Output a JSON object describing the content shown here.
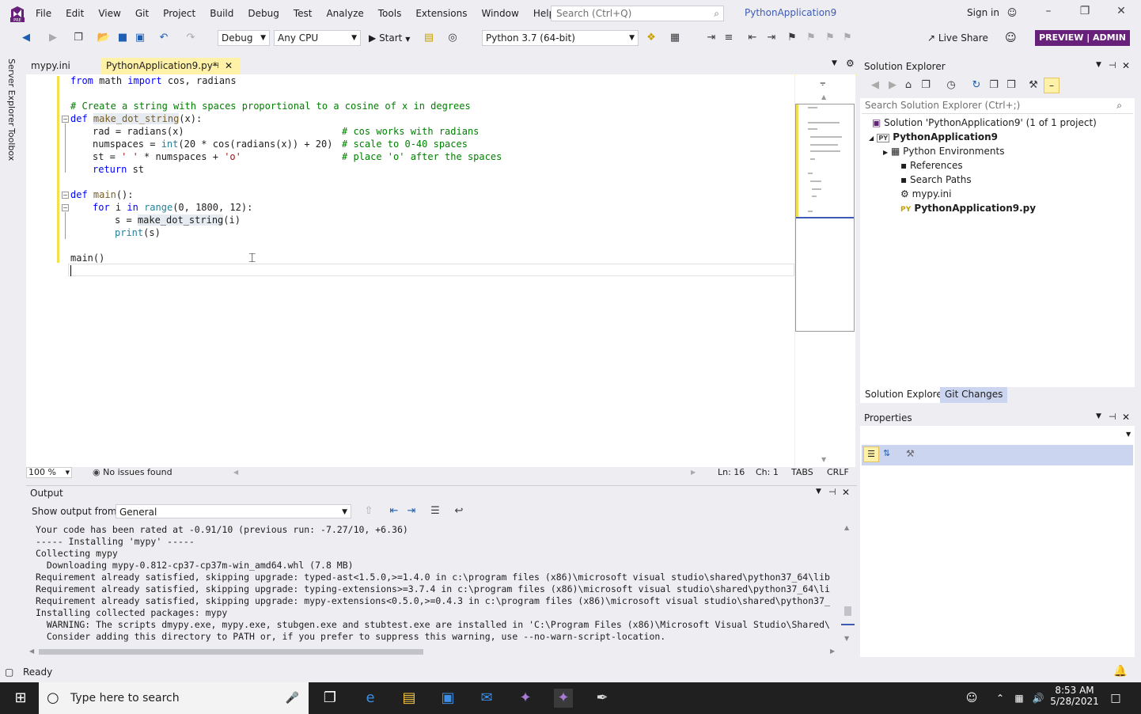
{
  "menu": [
    "File",
    "Edit",
    "View",
    "Git",
    "Project",
    "Build",
    "Debug",
    "Test",
    "Analyze",
    "Tools",
    "Extensions",
    "Window",
    "Help"
  ],
  "search_placeholder": "Search (Ctrl+Q)",
  "project_name": "PythonApplication9",
  "sign_in": "Sign in",
  "toolbar": {
    "config": "Debug",
    "platform": "Any CPU",
    "start": "Start",
    "env": "Python 3.7 (64-bit)",
    "live_share": "Live Share",
    "preview": "PREVIEW | ADMIN"
  },
  "left_rail": {
    "server_explorer": "Server Explorer",
    "toolbox": "Toolbox"
  },
  "tabs": {
    "mypy": "mypy.ini",
    "py": "PythonApplication9.py*"
  },
  "code": [
    {
      "t": "from",
      "c": "kw"
    },
    {
      "t": " math ",
      "c": ""
    },
    {
      "t": "import",
      "c": "kw"
    },
    {
      "t": " cos, radians",
      "c": ""
    }
  ],
  "code_lines": {
    "l1": [
      "from",
      "math",
      "import",
      "cos, radians"
    ],
    "comment": "# Create a string with spaces proportional to a cosine of x in degrees",
    "def1_kw": "def",
    "def1_name": "make_dot_string",
    "def1_args": "(x):",
    "l_rad": "rad = radians(x)",
    "c_rad": "# cos works with radians",
    "l_num_a": "numspaces = ",
    "l_num_int": "int",
    "l_num_b": "(20 * cos(radians(x)) + 20)",
    "c_num": "# scale to 0-40 spaces",
    "l_st_a": "st = ",
    "l_st_s1": "' '",
    "l_st_b": " * numspaces + ",
    "l_st_s2": "'o'",
    "c_st": "# place 'o' after the spaces",
    "l_ret_kw": "return",
    "l_ret": " st",
    "def2_kw": "def",
    "def2_name": "main",
    "def2_args": "():",
    "for_kw": "for",
    "for_a": " i ",
    "in_kw": "in",
    "range": "range",
    "for_b": "(0, 1800, 12):",
    "s_a": "s = ",
    "s_call": "make_dot_string",
    "s_b": "(i)",
    "print": "print",
    "print_b": "(s)",
    "main_call": "main()"
  },
  "editor_status": {
    "zoom": "100 %",
    "issues": "No issues found",
    "ln": "Ln: 16",
    "ch": "Ch: 1",
    "tabs": "TABS",
    "eol": "CRLF"
  },
  "output": {
    "title": "Output",
    "show_from_label": "Show output from:",
    "source": "General",
    "lines": [
      "Your code has been rated at -0.91/10 (previous run: -7.27/10, +6.36)",
      "----- Installing 'mypy' -----",
      "Collecting mypy",
      "  Downloading mypy-0.812-cp37-cp37m-win_amd64.whl (7.8 MB)",
      "Requirement already satisfied, skipping upgrade: typed-ast<1.5.0,>=1.4.0 in c:\\program files (x86)\\microsoft visual studio\\shared\\python37_64\\lib",
      "Requirement already satisfied, skipping upgrade: typing-extensions>=3.7.4 in c:\\program files (x86)\\microsoft visual studio\\shared\\python37_64\\li",
      "Requirement already satisfied, skipping upgrade: mypy-extensions<0.5.0,>=0.4.3 in c:\\program files (x86)\\microsoft visual studio\\shared\\python37_",
      "Installing collected packages: mypy",
      "  WARNING: The scripts dmypy.exe, mypy.exe, stubgen.exe and stubtest.exe are installed in 'C:\\Program Files (x86)\\Microsoft Visual Studio\\Shared\\",
      "  Consider adding this directory to PATH or, if you prefer to suppress this warning, use --no-warn-script-location."
    ]
  },
  "solution_explorer": {
    "title": "Solution Explorer",
    "search": "Search Solution Explorer (Ctrl+;)",
    "solution": "Solution 'PythonApplication9' (1 of 1 project)",
    "project": "PythonApplication9",
    "env": "Python Environments",
    "refs": "References",
    "paths": "Search Paths",
    "mypy": "mypy.ini",
    "pyfile": "PythonApplication9.py",
    "tab1": "Solution Explorer",
    "tab2": "Git Changes"
  },
  "properties": {
    "title": "Properties"
  },
  "status": {
    "ready": "Ready"
  },
  "taskbar": {
    "search": "Type here to search",
    "time": "8:53 AM",
    "date": "5/28/2021"
  },
  "colors": {
    "accent": "#68217a",
    "tab_active": "#fff1a8",
    "link": "#3d5bb5"
  }
}
